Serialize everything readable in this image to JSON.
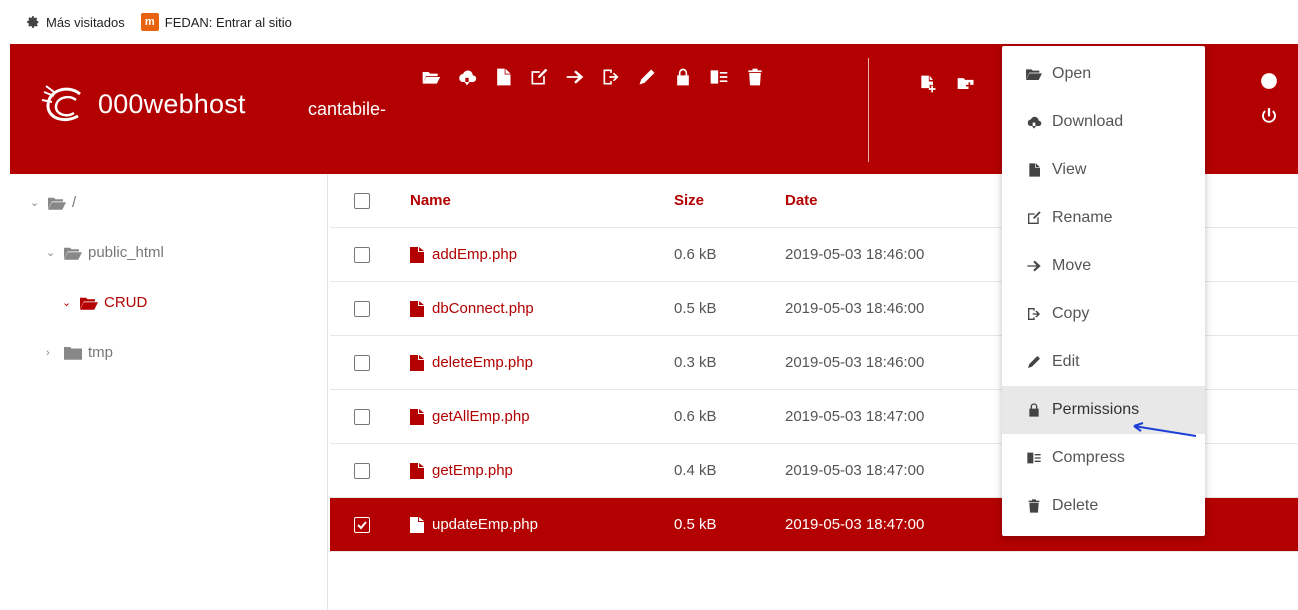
{
  "bookmarks": {
    "most_visited": "Más visitados",
    "fedan_icon": "m",
    "fedan": "FEDAN: Entrar al sitio"
  },
  "header": {
    "brand": "000webhost",
    "account": "cantabile-",
    "bg_color": "#b30000"
  },
  "tree": {
    "root": "/",
    "public_html": "public_html",
    "crud": "CRUD",
    "tmp": "tmp"
  },
  "table": {
    "headers": {
      "name": "Name",
      "size": "Size",
      "date": "Date"
    },
    "rows": [
      {
        "name": "addEmp.php",
        "size": "0.6 kB",
        "date": "2019-05-03 18:46:00"
      },
      {
        "name": "dbConnect.php",
        "size": "0.5 kB",
        "date": "2019-05-03 18:46:00"
      },
      {
        "name": "deleteEmp.php",
        "size": "0.3 kB",
        "date": "2019-05-03 18:46:00"
      },
      {
        "name": "getAllEmp.php",
        "size": "0.6 kB",
        "date": "2019-05-03 18:47:00"
      },
      {
        "name": "getEmp.php",
        "size": "0.4 kB",
        "date": "2019-05-03 18:47:00"
      },
      {
        "name": "updateEmp.php",
        "size": "0.5 kB",
        "date": "2019-05-03 18:47:00"
      }
    ]
  },
  "menu": {
    "open": "Open",
    "download": "Download",
    "view": "View",
    "rename": "Rename",
    "move": "Move",
    "copy": "Copy",
    "edit": "Edit",
    "permissions": "Permissions",
    "compress": "Compress",
    "delete": "Delete"
  }
}
